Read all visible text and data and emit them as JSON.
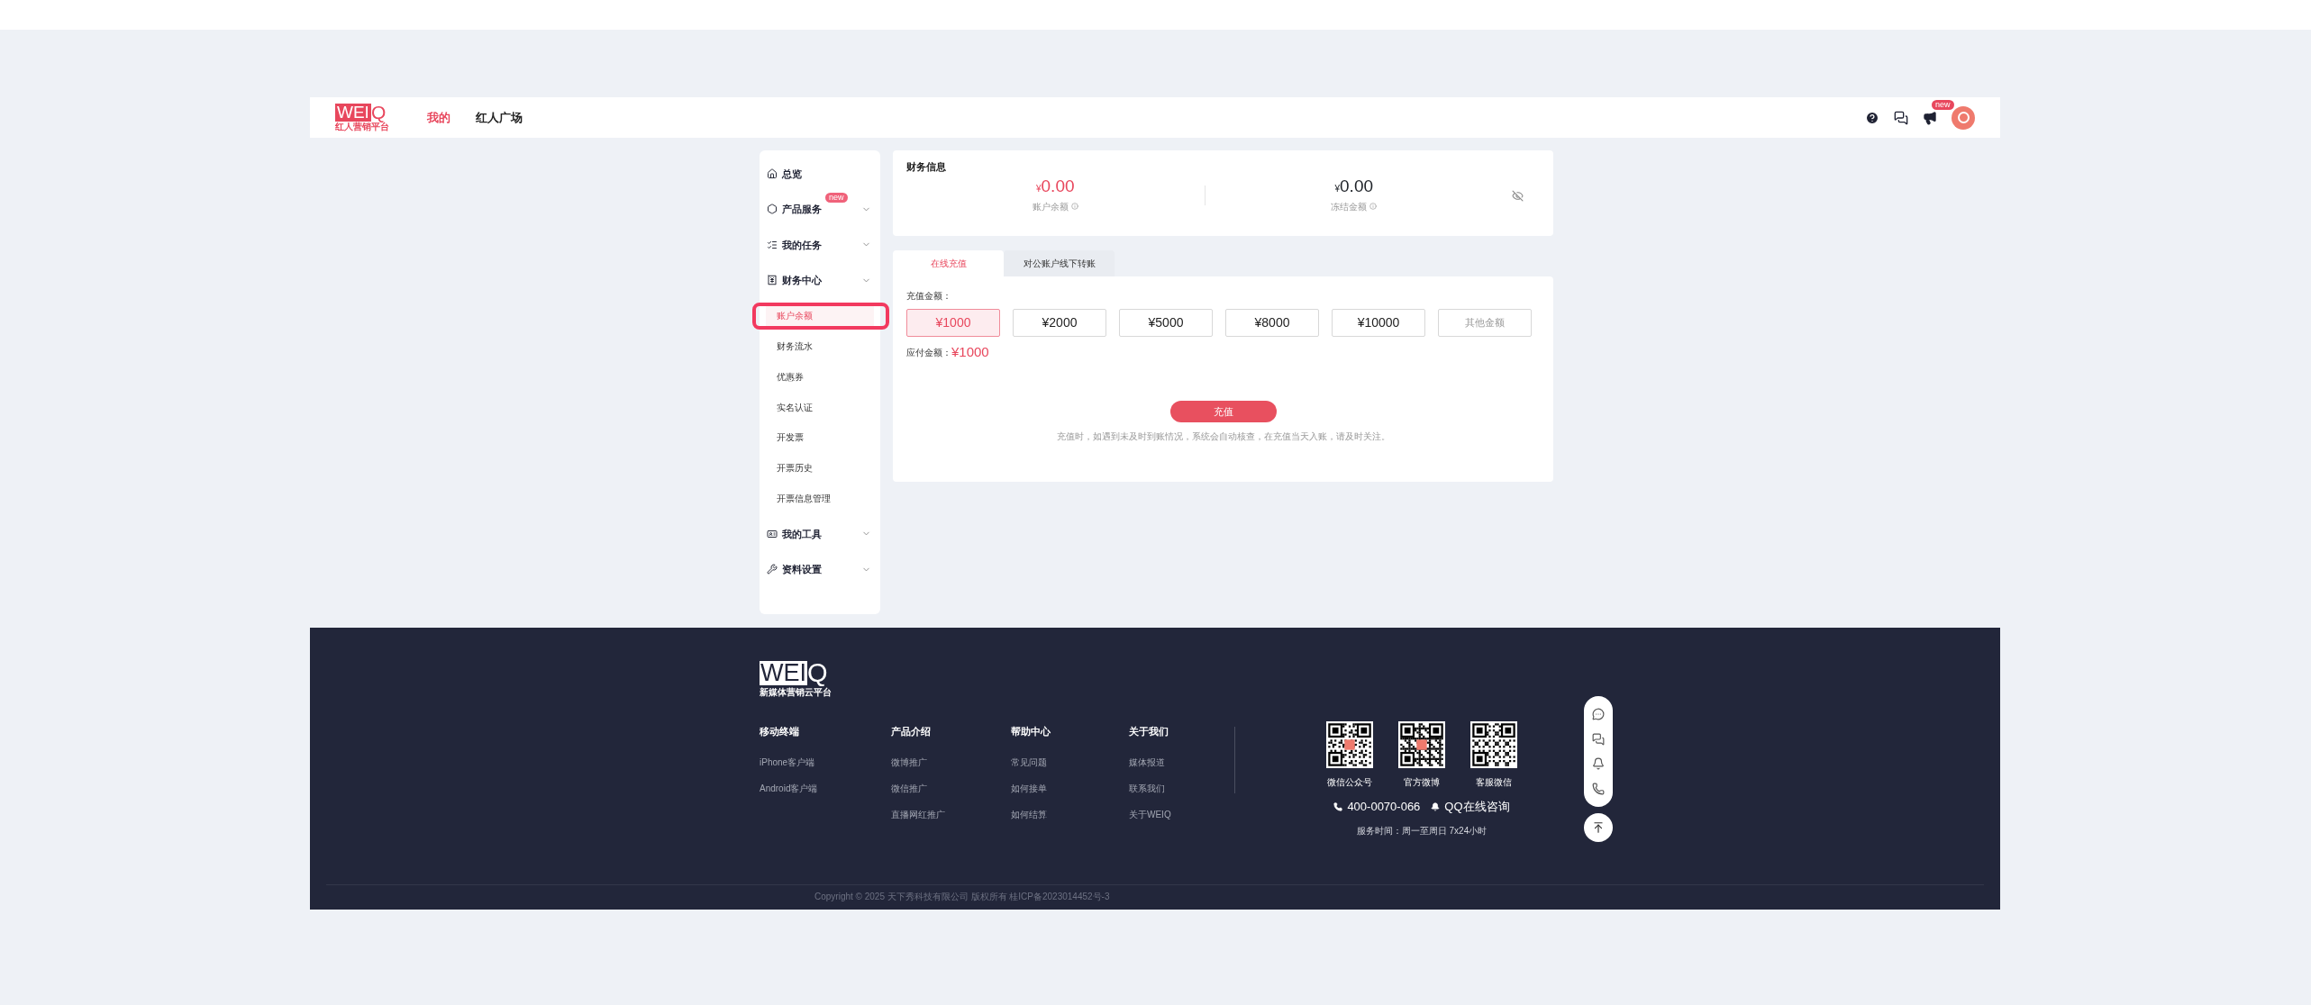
{
  "header": {
    "logo": {
      "mark": "WEI",
      "letter": "Q",
      "tagline": "红人营销平台"
    },
    "nav": [
      {
        "label": "我的",
        "selected": true
      },
      {
        "label": "红人广场",
        "selected": false
      }
    ],
    "notice_badge": "new"
  },
  "sidebar": {
    "items": [
      {
        "label": "总览",
        "kind": "link"
      },
      {
        "label": "产品服务",
        "badge": "new",
        "kind": "group"
      },
      {
        "label": "我的任务",
        "kind": "group"
      },
      {
        "label": "财务中心",
        "kind": "group",
        "children": [
          {
            "label": "账户余额",
            "selected": true
          },
          {
            "label": "财务流水",
            "selected": false
          },
          {
            "label": "优惠券",
            "selected": false
          },
          {
            "label": "实名认证",
            "selected": false
          },
          {
            "label": "开发票",
            "selected": false
          },
          {
            "label": "开票历史",
            "selected": false
          },
          {
            "label": "开票信息管理",
            "selected": false
          }
        ]
      },
      {
        "label": "我的工具",
        "kind": "group"
      },
      {
        "label": "资料设置",
        "kind": "group"
      }
    ]
  },
  "finance": {
    "title": "财务信息",
    "stats": [
      {
        "currency": "¥",
        "amount": "0.00",
        "label": "账户余额",
        "color": "#e8475d"
      },
      {
        "currency": "¥",
        "amount": "0.00",
        "label": "冻结金额",
        "color": "#1f2329"
      }
    ]
  },
  "tabs": [
    {
      "label": "在线充值",
      "selected": true
    },
    {
      "label": "对公账户线下转账",
      "selected": false
    }
  ],
  "recharge": {
    "label": "充值金额：",
    "options": [
      {
        "kind": "amount",
        "label": "¥1000",
        "selected": true
      },
      {
        "kind": "amount",
        "label": "¥2000",
        "selected": false
      },
      {
        "kind": "amount",
        "label": "¥5000",
        "selected": false
      },
      {
        "kind": "amount",
        "label": "¥8000",
        "selected": false
      },
      {
        "kind": "amount",
        "label": "¥10000",
        "selected": false
      },
      {
        "kind": "custom",
        "label": "其他金额",
        "selected": false
      }
    ],
    "payable_label": "应付金额：",
    "payable": "¥1000",
    "button": "充值",
    "note": "充值时，如遇到未及时到账情况，系统会自动核查，在充值当天入账，请及时关注。"
  },
  "footer": {
    "logo": {
      "mark": "WEI",
      "letter": "Q",
      "tagline": "新媒体营销云平台"
    },
    "columns": [
      {
        "title": "移动终端",
        "links": [
          "iPhone客户端",
          "Android客户端"
        ]
      },
      {
        "title": "产品介绍",
        "links": [
          "微博推广",
          "微信推广",
          "直播网红推广"
        ]
      },
      {
        "title": "帮助中心",
        "links": [
          "常见问题",
          "如何接单",
          "如何结算"
        ]
      },
      {
        "title": "关于我们",
        "links": [
          "媒体报道",
          "联系我们",
          "关于WEIQ"
        ]
      }
    ],
    "qr_codes": [
      {
        "label": "微信公众号"
      },
      {
        "label": "官方微博"
      },
      {
        "label": "客服微信"
      }
    ],
    "phone": "400-0070-066",
    "qq": "QQ在线咨询",
    "service_hours": "服务时间：周一至周日 7x24小时",
    "copyright": "Copyright © 2025 天下秀科技有限公司 版权所有 桂ICP备2023014452号-3"
  }
}
